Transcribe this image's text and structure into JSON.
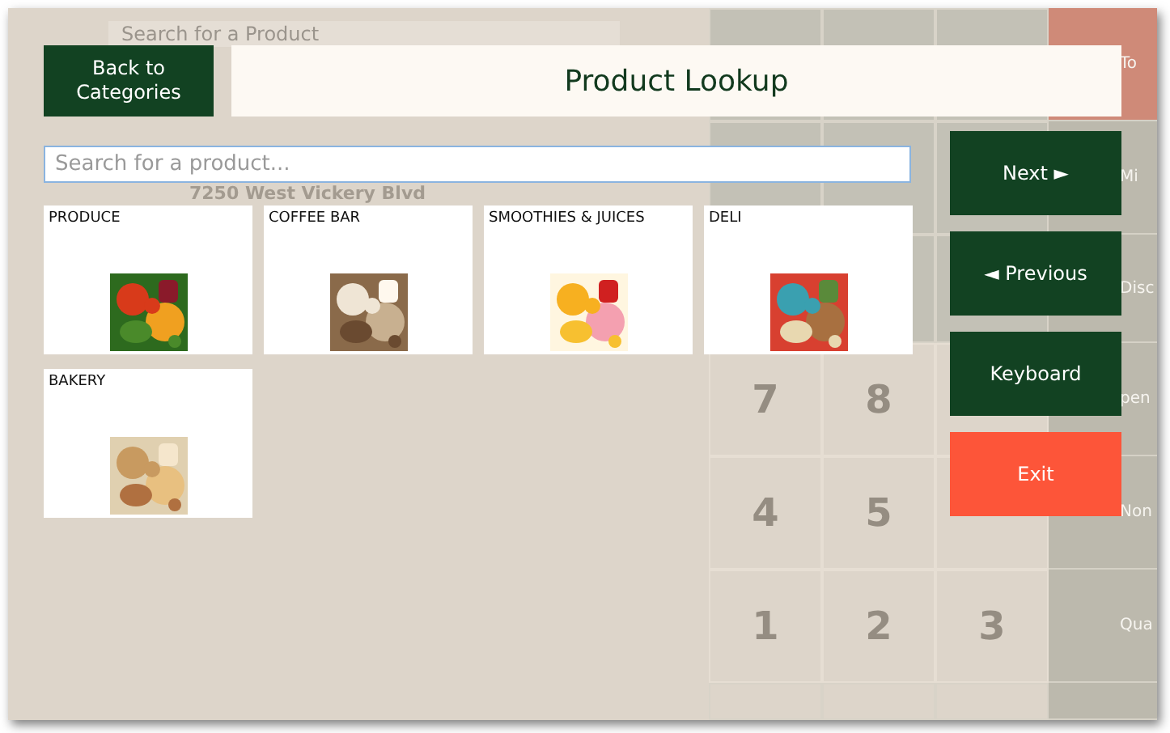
{
  "background": {
    "search_placeholder": "Search for a Product",
    "address": "7250 West Vickery Blvd",
    "side_labels": [
      "To",
      "Mi",
      "Disc",
      "pen",
      "Non",
      "Qua"
    ],
    "keypad": [
      [
        "7",
        "8"
      ],
      [
        "4",
        "5"
      ],
      [
        "1",
        "2",
        "3"
      ]
    ]
  },
  "dialog": {
    "back_button": "Back to\nCategories",
    "title": "Product Lookup",
    "search": {
      "placeholder": "Search for a product..."
    },
    "categories": [
      {
        "name": "PRODUCE",
        "kind": "picture"
      },
      {
        "name": "COFFEE BAR",
        "kind": "picture"
      },
      {
        "name": "SMOOTHIES & JUICES",
        "kind": "picture"
      },
      {
        "name": "DELI",
        "kind": "picture"
      },
      {
        "name": "BAKERY",
        "kind": "picture"
      }
    ],
    "buttons": [
      {
        "label": "Next ►",
        "kind": "nav"
      },
      {
        "label": "◄ Previous",
        "kind": "nav"
      },
      {
        "label": "Keyboard",
        "kind": "nav"
      },
      {
        "label": "Exit",
        "kind": "exit"
      }
    ]
  }
}
